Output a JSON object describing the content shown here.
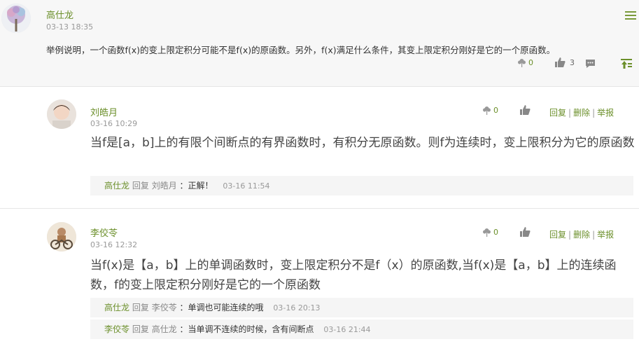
{
  "post": {
    "author": "高仕龙",
    "time": "03-13 18:35",
    "body": "举例说明，一个函数f(x)的变上限定积分可能不是f(x)的原函数。另外，f(x)满足什么条件，其变上限定积分刚好是它的一个原函数。",
    "flowers": "0",
    "likes": "3"
  },
  "replies": [
    {
      "author": "刘皓月",
      "time": "03-16 10:29",
      "flowers": "0",
      "body": "当f是[a，b]上的有限个间断点的有界函数时，有积分无原函数。则f为连续时，变上限积分为它的原函数",
      "actions": {
        "reply": "回复",
        "delete": "删除",
        "report": "举报",
        "sep": "|"
      },
      "subs": [
        {
          "from": "高仕龙",
          "verb": "回复",
          "to": "刘皓月",
          "text": "：正解！",
          "time": "03-16 11:54"
        }
      ]
    },
    {
      "author": "李佼苓",
      "time": "03-16 12:32",
      "flowers": "0",
      "body": "当f(x)是【a，b】上的单调函数时，变上限定积分不是f（x）的原函数,当f(x)是【a，b】上的连续函数，f的变上限定积分刚好是它的一个原函数",
      "actions": {
        "reply": "回复",
        "delete": "删除",
        "report": "举报",
        "sep": "|"
      },
      "subs": [
        {
          "from": "高仕龙",
          "verb": "回复",
          "to": "李佼苓",
          "text": "：单调也可能连续的哦",
          "time": "03-16 20:13"
        },
        {
          "from": "李佼苓",
          "verb": "回复",
          "to": "高仕龙",
          "text": "：当单调不连续的时候，含有间断点",
          "time": "03-16 21:44"
        }
      ]
    }
  ],
  "colors": {
    "accent": "#6b8f2a",
    "post_bg": "#f7f7f7",
    "sub_bg": "#f5f5f5"
  },
  "icons": {
    "flower": "flower-icon",
    "like": "thumbs-up-icon",
    "comment": "comment-icon",
    "top": "pin-top-icon",
    "menu": "menu-icon"
  }
}
